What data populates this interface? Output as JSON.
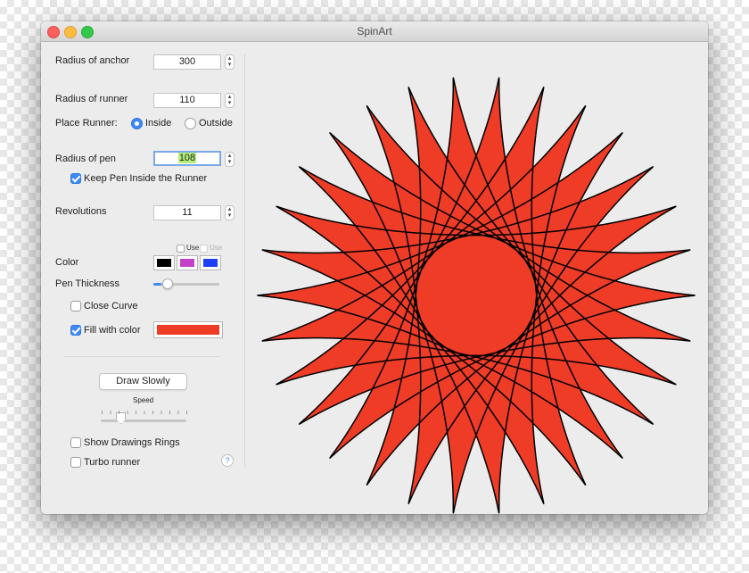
{
  "window": {
    "title": "SpinArt"
  },
  "controls": {
    "radius_anchor": {
      "label": "Radius of anchor",
      "value": "300"
    },
    "radius_runner": {
      "label": "Radius of runner",
      "value": "110"
    },
    "place_runner": {
      "label": "Place Runner:",
      "inside_label": "Inside",
      "outside_label": "Outside",
      "selected": "Inside"
    },
    "radius_pen": {
      "label": "Radius of pen",
      "value": "108"
    },
    "keep_pen": {
      "label": "Keep Pen Inside the Runner",
      "checked": true
    },
    "revolutions": {
      "label": "Revolutions",
      "value": "11"
    },
    "color": {
      "label": "Color",
      "use_label_1": "Use",
      "use_label_2": "Use",
      "swatches": [
        "#000000",
        "#c341c8",
        "#1d3ff5"
      ]
    },
    "pen_thickness": {
      "label": "Pen Thickness",
      "level": 0.06
    },
    "close_curve": {
      "label": "Close Curve",
      "checked": false
    },
    "fill_color": {
      "label": "Fill with color",
      "checked": true,
      "color": "#ef3c27"
    },
    "draw_button": {
      "label": "Draw Slowly"
    },
    "speed": {
      "label": "Speed",
      "level": 0.2
    },
    "show_rings": {
      "label": "Show Drawings Rings",
      "checked": false
    },
    "turbo": {
      "label": "Turbo runner",
      "checked": false
    },
    "help": {
      "label": "?"
    }
  },
  "colors": {
    "accent": "#3d8af7",
    "fill": "#ef3c27",
    "stroke": "#000000",
    "focus_highlight": "#b3f07a"
  },
  "icons": [
    "close-icon",
    "minimize-icon",
    "zoom-icon",
    "stepper-arrows-icon",
    "help-icon"
  ]
}
